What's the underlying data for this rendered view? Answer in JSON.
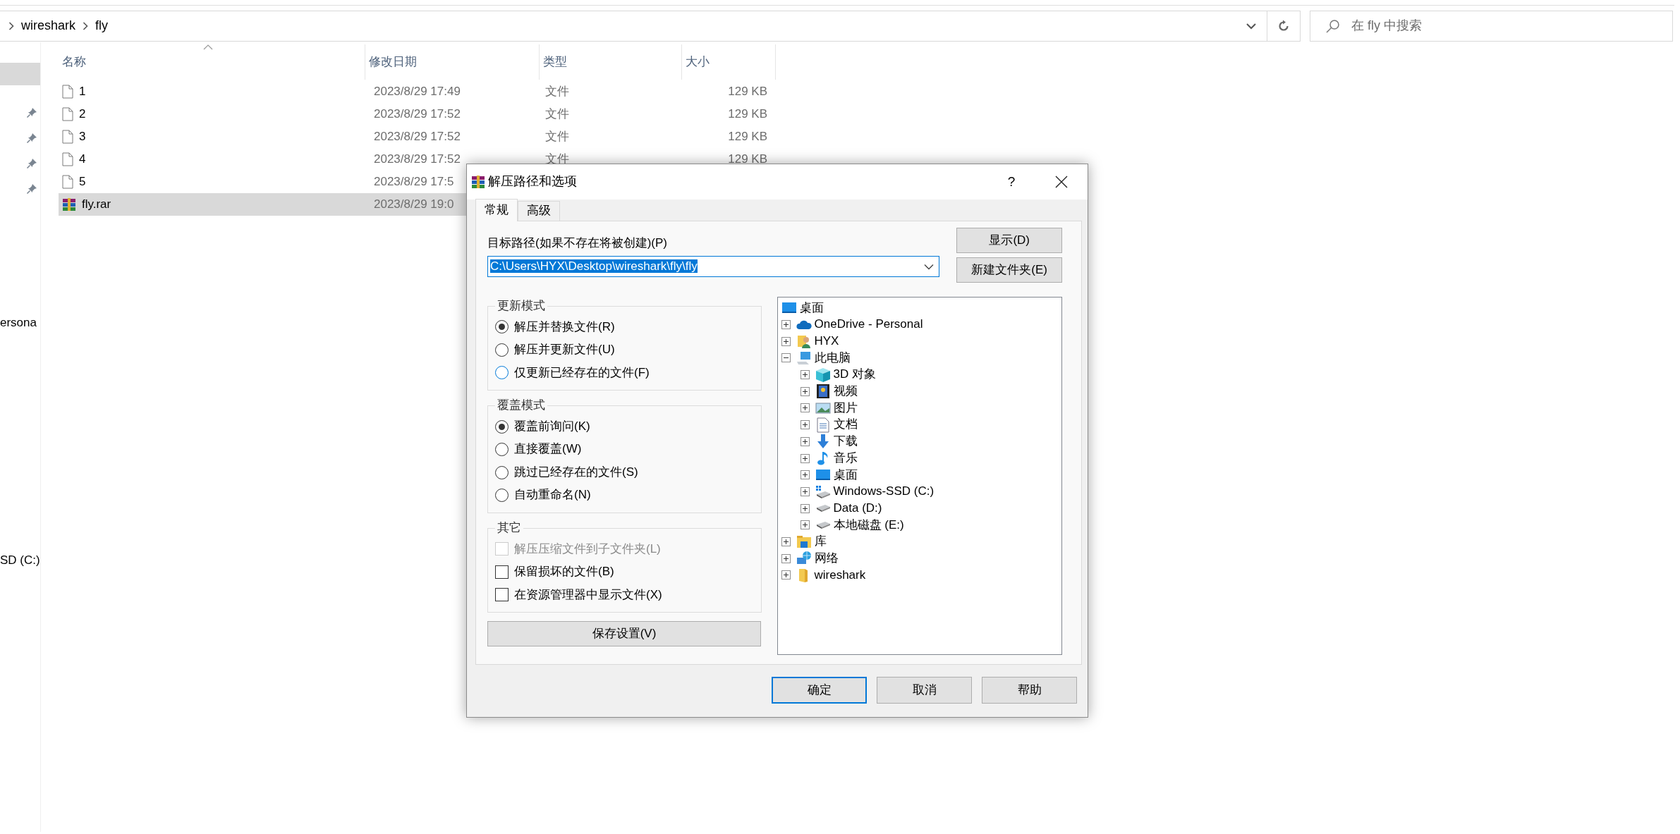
{
  "explorer": {
    "breadcrumb": [
      "wireshark",
      "fly"
    ],
    "search": {
      "placeholder": "在 fly 中搜索"
    },
    "sidebar": {
      "sections": [
        {
          "items": [
            {
              "selected": true,
              "pinned": false
            },
            {
              "selected": false,
              "pinned": true
            },
            {
              "selected": false,
              "pinned": true
            },
            {
              "selected": false,
              "pinned": true
            },
            {
              "selected": false,
              "pinned": true
            }
          ]
        },
        {
          "items": [
            {
              "label": "ersona"
            }
          ]
        },
        {
          "items": [
            {
              "label": "SD (C:)"
            }
          ]
        }
      ]
    },
    "columns": [
      "名称",
      "修改日期",
      "类型",
      "大小"
    ],
    "rows": [
      {
        "kind": "file",
        "name": "1",
        "date": "2023/8/29 17:49",
        "type": "文件",
        "size": "129 KB",
        "selected": false
      },
      {
        "kind": "file",
        "name": "2",
        "date": "2023/8/29 17:52",
        "type": "文件",
        "size": "129 KB",
        "selected": false
      },
      {
        "kind": "file",
        "name": "3",
        "date": "2023/8/29 17:52",
        "type": "文件",
        "size": "129 KB",
        "selected": false
      },
      {
        "kind": "file",
        "name": "4",
        "date": "2023/8/29 17:52",
        "type": "文件",
        "size": "129 KB",
        "selected": false
      },
      {
        "kind": "file",
        "name": "5",
        "date": "2023/8/29 17:5",
        "selected": false
      },
      {
        "kind": "archive",
        "name": "fly.rar",
        "date": "2023/8/29 19:0",
        "selected": true
      }
    ]
  },
  "dialog": {
    "title": "解压路径和选项",
    "help": "?",
    "tabs": [
      {
        "label": "常规",
        "selected": true
      },
      {
        "label": "高级",
        "selected": false
      }
    ],
    "path": {
      "label": "目标路径(如果不存在将被创建)(P)",
      "value": "C:\\Users\\HYX\\Desktop\\wireshark\\fly\\fly",
      "selected": true
    },
    "side_buttons": [
      "显示(D)",
      "新建文件夹(E)"
    ],
    "groups": [
      {
        "title": "更新模式",
        "items": [
          {
            "kind": "radio",
            "label": "解压并替换文件(R)",
            "selected": true,
            "focused": false
          },
          {
            "kind": "radio",
            "label": "解压并更新文件(U)",
            "selected": false,
            "focused": false
          },
          {
            "kind": "radio",
            "label": "仅更新已经存在的文件(F)",
            "selected": false,
            "focused": true
          }
        ]
      },
      {
        "title": "覆盖模式",
        "items": [
          {
            "kind": "radio",
            "label": "覆盖前询问(K)",
            "selected": true,
            "focused": false
          },
          {
            "kind": "radio",
            "label": "直接覆盖(W)",
            "selected": false,
            "focused": false
          },
          {
            "kind": "radio",
            "label": "跳过已经存在的文件(S)",
            "selected": false,
            "focused": false
          },
          {
            "kind": "radio",
            "label": "自动重命名(N)",
            "selected": false,
            "focused": false
          }
        ]
      },
      {
        "title": "其它",
        "items": [
          {
            "kind": "checkbox",
            "label": "解压压缩文件到子文件夹(L)",
            "checked": false,
            "disabled": true
          },
          {
            "kind": "checkbox",
            "label": "保留损坏的文件(B)",
            "checked": false,
            "disabled": false
          },
          {
            "kind": "checkbox",
            "label": "在资源管理器中显示文件(X)",
            "checked": false,
            "disabled": false
          }
        ]
      }
    ],
    "save_button": "保存设置(V)",
    "tree": {
      "label": "桌面",
      "kind": "desktop",
      "children": [
        {
          "label": "OneDrive - Personal",
          "kind": "cloud",
          "expanded": false
        },
        {
          "label": "HYX",
          "kind": "user",
          "expanded": false
        },
        {
          "label": "此电脑",
          "kind": "computer",
          "expanded": true,
          "children": [
            {
              "label": "3D 对象",
              "kind": "cube",
              "expanded": false
            },
            {
              "label": "视频",
              "kind": "film",
              "expanded": false
            },
            {
              "label": "图片",
              "kind": "image",
              "expanded": false
            },
            {
              "label": "文档",
              "kind": "document",
              "expanded": false
            },
            {
              "label": "下载",
              "kind": "download",
              "expanded": false
            },
            {
              "label": "音乐",
              "kind": "music",
              "expanded": false
            },
            {
              "label": "桌面",
              "kind": "desktop",
              "expanded": false
            },
            {
              "label": "Windows-SSD (C:)",
              "kind": "system-drive",
              "expanded": false
            },
            {
              "label": "Data (D:)",
              "kind": "drive",
              "expanded": false
            },
            {
              "label": "本地磁盘 (E:)",
              "kind": "drive",
              "expanded": false
            }
          ]
        },
        {
          "label": "库",
          "kind": "library",
          "expanded": false
        },
        {
          "label": "网络",
          "kind": "network",
          "expanded": false
        },
        {
          "label": "wireshark",
          "kind": "folder",
          "expanded": false
        }
      ]
    },
    "buttons": [
      {
        "label": "确定",
        "default": true
      },
      {
        "label": "取消",
        "default": false
      },
      {
        "label": "帮助",
        "default": false
      }
    ]
  }
}
